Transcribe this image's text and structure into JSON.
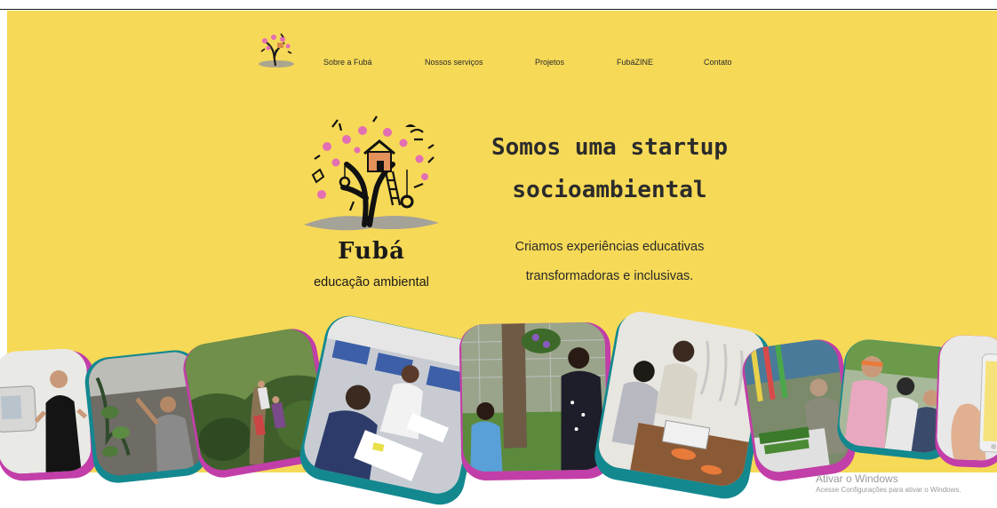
{
  "nav": {
    "logo_icon": "fuba-tree-logo-icon",
    "items": [
      {
        "label": "Sobre a Fubá"
      },
      {
        "label": "Nossos serviços"
      },
      {
        "label": "Projetos"
      },
      {
        "label": "FubáZINE"
      },
      {
        "label": "Contato"
      }
    ]
  },
  "hero": {
    "logo_icon": "fuba-tree-logo-icon",
    "brand_name": "Fubá",
    "brand_tagline": "educação ambiental",
    "headline_line1": "Somos uma startup",
    "headline_line2": "socioambiental",
    "subtext_line1": "Criamos experiências educativas",
    "subtext_line2": "transformadoras e inclusivas."
  },
  "photos": [
    {
      "icon": "sign-language-camera-photo"
    },
    {
      "icon": "plants-hanging-photo"
    },
    {
      "icon": "forest-trail-photo"
    },
    {
      "icon": "classroom-photo"
    },
    {
      "icon": "tree-flowers-photo"
    },
    {
      "icon": "workshop-table-photo"
    },
    {
      "icon": "seedlings-table-photo"
    },
    {
      "icon": "group-outdoor-photo"
    },
    {
      "icon": "phone-hand-photo"
    }
  ],
  "watermark": {
    "title": "Ativar o Windows",
    "subtitle": "Acesse Configurações para ativar o Windows."
  },
  "colors": {
    "background": "#f6d957",
    "frame_magenta": "#c23ea8",
    "frame_teal": "#13888f",
    "text_dark": "#2a2a2a"
  }
}
